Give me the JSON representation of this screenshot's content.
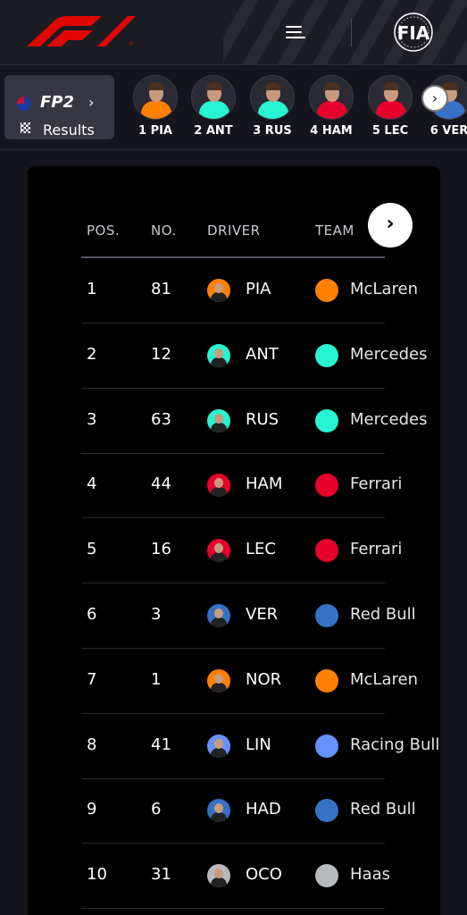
{
  "header": {
    "brand": "F1",
    "org": "FIA"
  },
  "session": {
    "name": "FP2",
    "results_label": "Results"
  },
  "driver_strip": [
    {
      "label": "1 PIA",
      "color": "#ff8000"
    },
    {
      "label": "2 ANT",
      "color": "#27f4d2"
    },
    {
      "label": "3 RUS",
      "color": "#27f4d2"
    },
    {
      "label": "4 HAM",
      "color": "#e8002d"
    },
    {
      "label": "5 LEC",
      "color": "#e8002d"
    },
    {
      "label": "6 VER",
      "color": "#3671c6"
    }
  ],
  "table": {
    "headers": {
      "pos": "POS.",
      "no": "NO.",
      "driver": "DRIVER",
      "team": "TEAM"
    },
    "rows": [
      {
        "pos": "1",
        "no": "81",
        "driver": "PIA",
        "team": "McLaren",
        "color": "#ff8000",
        "team_icon": "mclaren-icon"
      },
      {
        "pos": "2",
        "no": "12",
        "driver": "ANT",
        "team": "Mercedes",
        "color": "#27f4d2",
        "team_icon": "mercedes-icon"
      },
      {
        "pos": "3",
        "no": "63",
        "driver": "RUS",
        "team": "Mercedes",
        "color": "#27f4d2",
        "team_icon": "mercedes-icon"
      },
      {
        "pos": "4",
        "no": "44",
        "driver": "HAM",
        "team": "Ferrari",
        "color": "#e8002d",
        "team_icon": "ferrari-icon"
      },
      {
        "pos": "5",
        "no": "16",
        "driver": "LEC",
        "team": "Ferrari",
        "color": "#e8002d",
        "team_icon": "ferrari-icon"
      },
      {
        "pos": "6",
        "no": "3",
        "driver": "VER",
        "team": "Red Bull",
        "color": "#3671c6",
        "team_icon": "red-bull-icon"
      },
      {
        "pos": "7",
        "no": "1",
        "driver": "NOR",
        "team": "McLaren",
        "color": "#ff8000",
        "team_icon": "mclaren-icon"
      },
      {
        "pos": "8",
        "no": "41",
        "driver": "LIN",
        "team": "Racing Bulls",
        "color": "#6692ff",
        "team_icon": "racing-bulls-icon"
      },
      {
        "pos": "9",
        "no": "6",
        "driver": "HAD",
        "team": "Red Bull",
        "color": "#3671c6",
        "team_icon": "red-bull-icon"
      },
      {
        "pos": "10",
        "no": "31",
        "driver": "OCO",
        "team": "Haas",
        "color": "#b6babd",
        "team_icon": "haas-icon"
      }
    ]
  }
}
